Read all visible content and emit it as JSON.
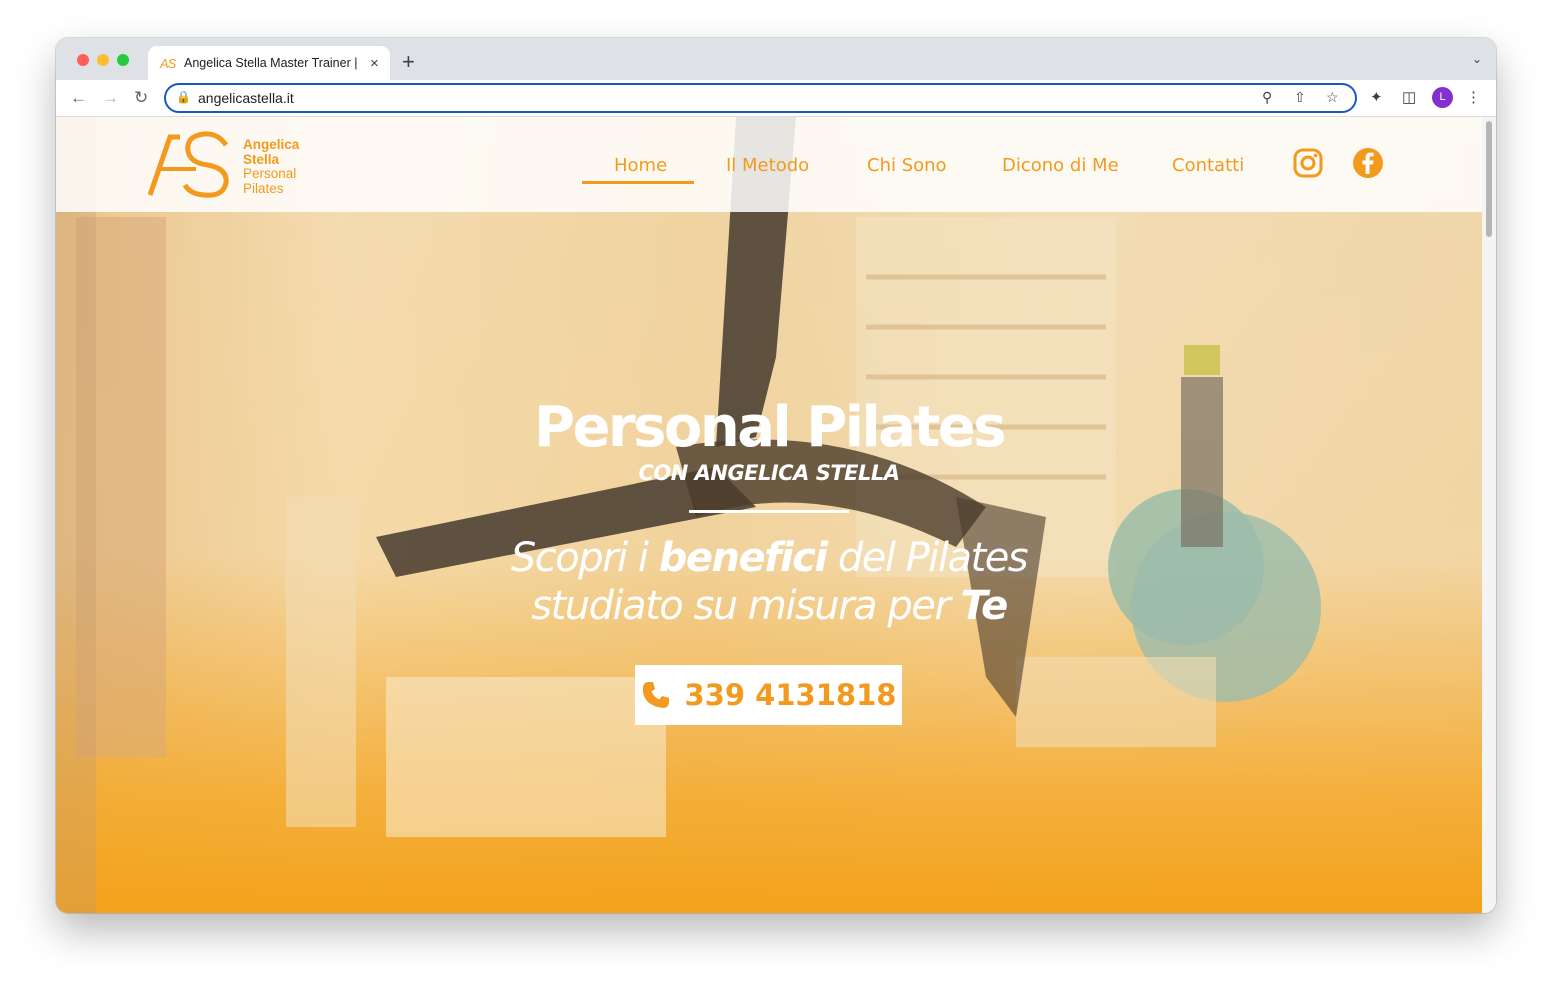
{
  "browser": {
    "tab_title": "Angelica Stella Master Trainer |",
    "tab_favicon_text": "AS",
    "tab_close_icon": "×",
    "new_tab_icon": "+",
    "url": "angelicastella.it",
    "avatar_initial": "L"
  },
  "site": {
    "logo": {
      "line1": "Angelica",
      "line2": "Stella",
      "line3": "Personal",
      "line4": "Pilates"
    },
    "nav": {
      "items": [
        {
          "label": "Home",
          "active": true
        },
        {
          "label": "Il Metodo",
          "active": false
        },
        {
          "label": "Chi Sono",
          "active": false
        },
        {
          "label": "Dicono di Me",
          "active": false
        },
        {
          "label": "Contatti",
          "active": false
        }
      ],
      "social": [
        "instagram-icon",
        "facebook-icon"
      ]
    },
    "hero": {
      "title": "Personal Pilates",
      "subtitle": "CON ANGELICA STELLA",
      "tagline": {
        "part1": "Scopri i ",
        "part2": "benefici",
        "part3": " del Pilates",
        "part4": "studiato su misura per ",
        "part5": "Te"
      },
      "phone": "339 4131818"
    }
  },
  "colors": {
    "accent": "#f39a1e",
    "omnibox_border": "#1a57c4",
    "avatar_bg": "#8430ce"
  }
}
